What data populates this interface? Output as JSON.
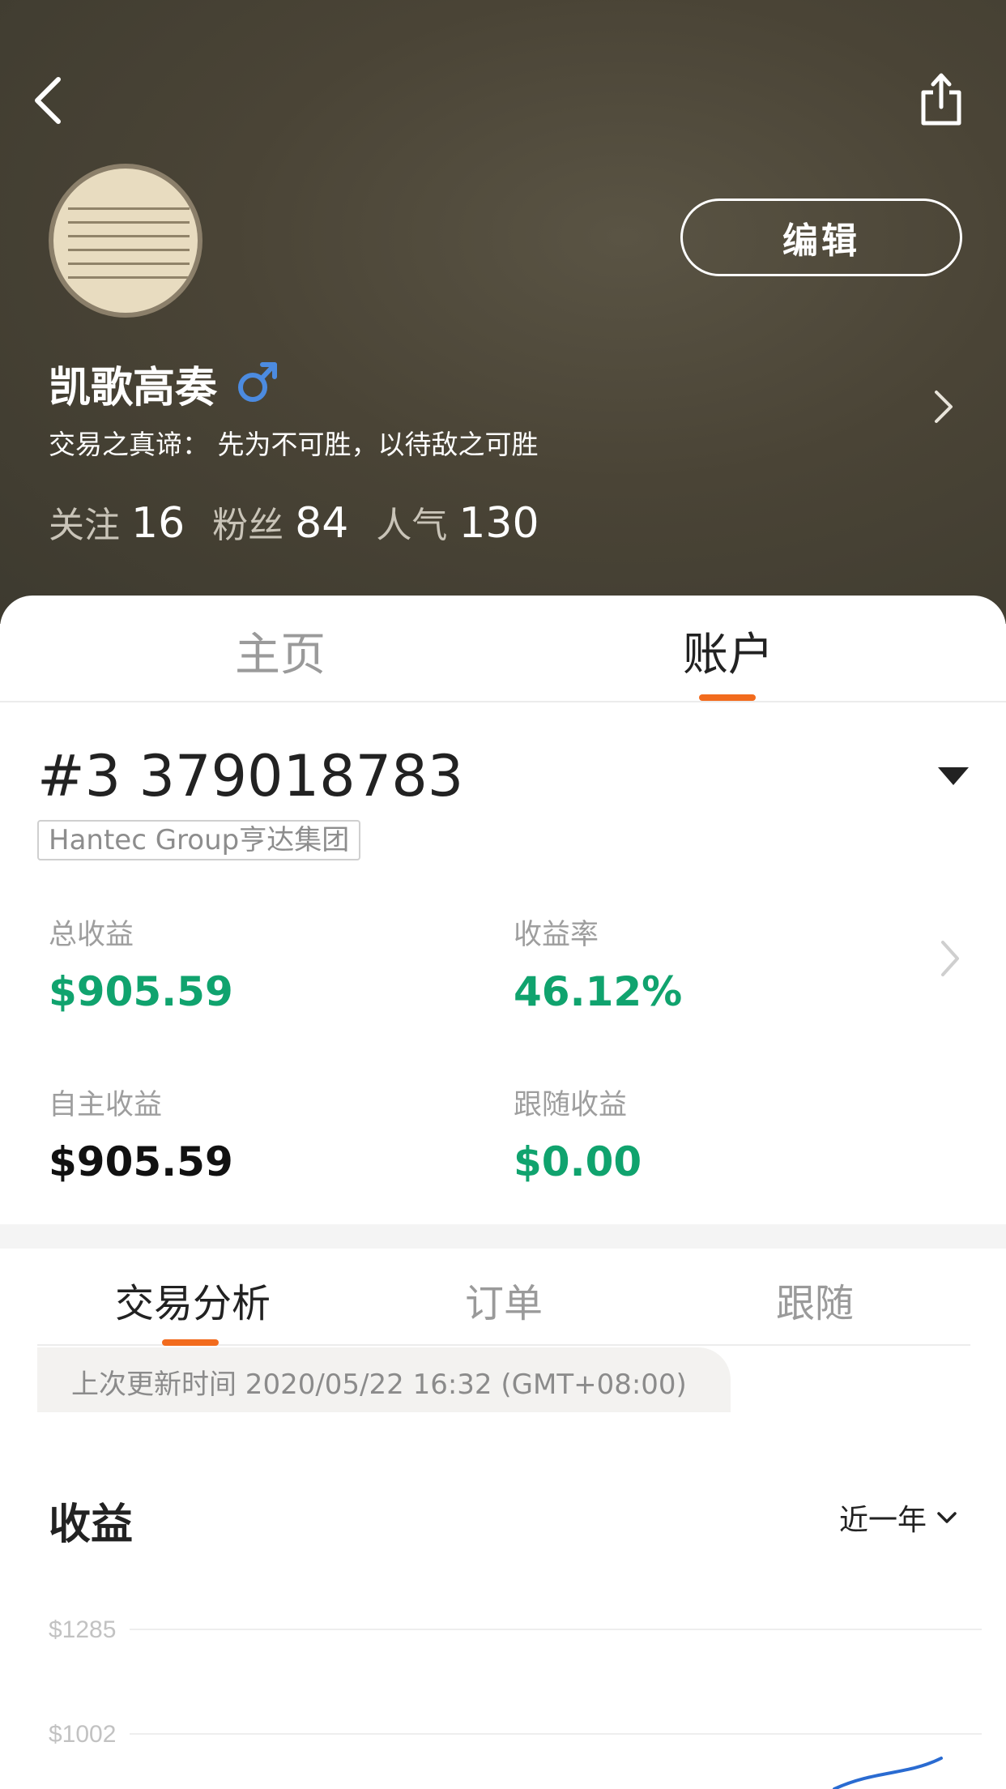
{
  "header": {
    "back_icon": "chevron-left-icon",
    "share_icon": "share-icon",
    "edit_label": "编辑",
    "user_name": "凯歌高奏",
    "gender_icon": "male-icon",
    "motto": "交易之真谛：  先为不可胜，以待敌之可胜",
    "stats": [
      {
        "label": "关注",
        "value": "16"
      },
      {
        "label": "粉丝",
        "value": "84"
      },
      {
        "label": "人气",
        "value": "130"
      }
    ]
  },
  "main_tabs": [
    {
      "label": "主页"
    },
    {
      "label": "账户"
    }
  ],
  "account": {
    "id": "#3 379018783",
    "broker": "Hantec Group亨达集团",
    "metrics": [
      {
        "label": "总收益",
        "value": "$905.59"
      },
      {
        "label": "收益率",
        "value": "46.12%"
      },
      {
        "label": "自主收益",
        "value": "$905.59"
      },
      {
        "label": "跟随收益",
        "value": "$0.00"
      }
    ]
  },
  "sub_tabs": [
    {
      "label": "交易分析"
    },
    {
      "label": "订单"
    },
    {
      "label": "跟随"
    }
  ],
  "update_text": "上次更新时间 2020/05/22 16:32 (GMT+08:00)",
  "earnings": {
    "title": "收益",
    "range": "近一年"
  },
  "colors": {
    "accent": "#f26b1d",
    "positive": "#10a36e",
    "line": "#2a6bd1"
  },
  "chart_data": {
    "type": "line",
    "title": "",
    "xlabel": "",
    "ylabel": "",
    "y_ticks": [
      "$1285",
      "$1002"
    ],
    "series": [
      {
        "values": [
          905.59,
          980
        ]
      }
    ]
  }
}
